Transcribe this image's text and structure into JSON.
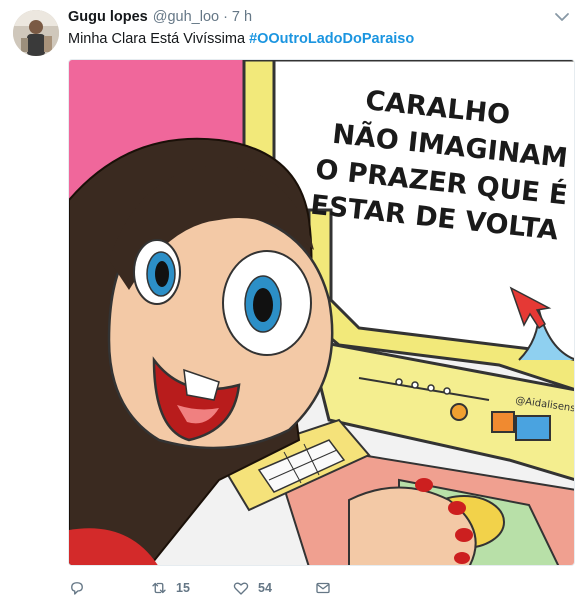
{
  "tweet": {
    "author_name": "Gugu lopes",
    "handle": "@guh_loo",
    "separator": "·",
    "time": "7 h",
    "text": "Minha Clara Está Vivíssima",
    "hashtag": "#OOutroLadoDoParaiso"
  },
  "media": {
    "caption_lines": [
      "CARALHO",
      "NÃO IMAGINAM",
      "O PRAZER QUE É",
      "ESTAR DE VOLTA"
    ],
    "watermark": "@Aidalisensa"
  },
  "actions": {
    "reply_icon": "reply-icon",
    "retweet_count": "15",
    "like_count": "54",
    "dm_icon": "envelope-icon"
  },
  "colors": {
    "hashtag": "#1b95e0",
    "meta_text": "#657786",
    "monitor_yellow": "#f2e97a",
    "wall_pink": "#f0679b",
    "skin": "#f3c9a6"
  }
}
